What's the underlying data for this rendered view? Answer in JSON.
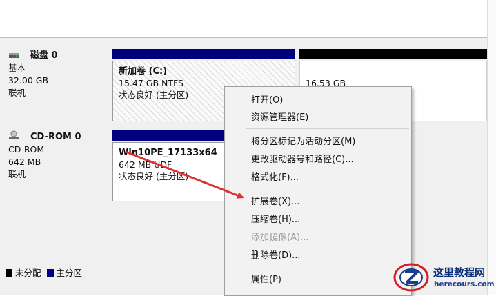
{
  "disks": [
    {
      "name": "磁盘 0",
      "type": "基本",
      "size": "32.00 GB",
      "status": "联机",
      "partitions": [
        {
          "name": "新加卷  (C:)",
          "size_fs": "15.47 GB NTFS",
          "status": "状态良好 (主分区)"
        },
        {
          "name": "",
          "size_fs": "16.53 GB",
          "status": ""
        }
      ]
    },
    {
      "name": "CD-ROM 0",
      "type": "CD-ROM",
      "size": "642 MB",
      "status": "联机",
      "partitions": [
        {
          "name": "Win10PE_17133x64",
          "size_fs": "642 MB UDF",
          "status": "状态良好 (主分区)"
        }
      ]
    }
  ],
  "legend": [
    {
      "label": "未分配",
      "color": "#000000"
    },
    {
      "label": "主分区",
      "color": "#00007f"
    }
  ],
  "context_menu": [
    {
      "label": "打开(O)",
      "enabled": true
    },
    {
      "label": "资源管理器(E)",
      "enabled": true
    },
    {
      "label": "将分区标记为活动分区(M)",
      "enabled": true
    },
    {
      "label": "更改驱动器号和路径(C)...",
      "enabled": true
    },
    {
      "label": "格式化(F)...",
      "enabled": true
    },
    {
      "label": "扩展卷(X)...",
      "enabled": true
    },
    {
      "label": "压缩卷(H)...",
      "enabled": true
    },
    {
      "label": "添加镜像(A)...",
      "enabled": false
    },
    {
      "label": "删除卷(D)...",
      "enabled": true
    },
    {
      "label": "属性(P)",
      "enabled": true
    }
  ],
  "watermark": {
    "name": "这里教程网",
    "url": "herecours.com"
  },
  "colors": {
    "primary_partition": "#00007f",
    "unallocated": "#000000",
    "arrow": "#e03030"
  },
  "icons": {
    "disk": "hard-disk-icon",
    "cdrom": "cdrom-icon",
    "watermark_logo": "z-logo-icon"
  }
}
